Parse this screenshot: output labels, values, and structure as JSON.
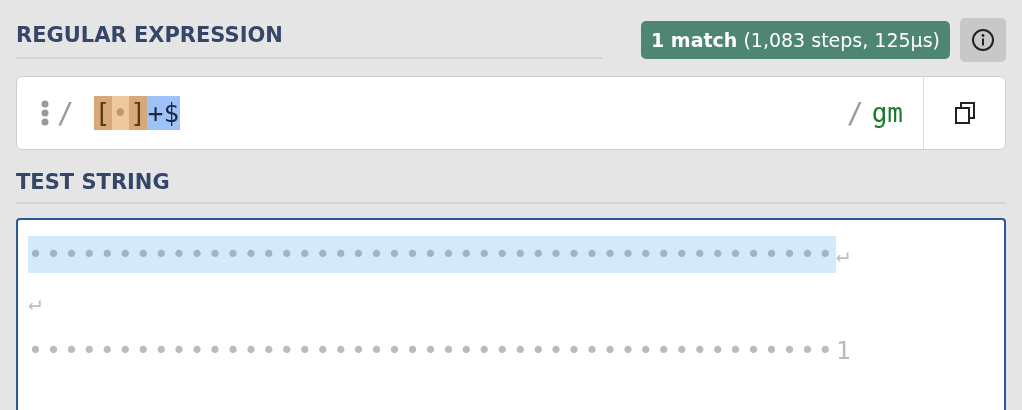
{
  "regex_section": {
    "title": "REGULAR EXPRESSION",
    "match_info": {
      "count": "1 match",
      "details": "(1,083 steps, 125µs)"
    }
  },
  "regex": {
    "open_delimiter": "/",
    "tokens": [
      {
        "text": "[",
        "kind": "class"
      },
      {
        "text": "•",
        "kind": "class-inner"
      },
      {
        "text": "]",
        "kind": "class"
      },
      {
        "text": "+$",
        "kind": "match-highlight"
      }
    ],
    "close_delimiter": "/",
    "flags": "gm"
  },
  "test_section": {
    "title": "TEST STRING"
  },
  "test_lines": [
    {
      "text": "•••••••••••••••••••••••••••••••••••••••••••••",
      "matched": true,
      "newline": "↵"
    },
    {
      "newline": "↵"
    },
    {
      "text": "•••••••••••••••••••••••••••••••••••••••••••••1",
      "matched": false
    }
  ]
}
